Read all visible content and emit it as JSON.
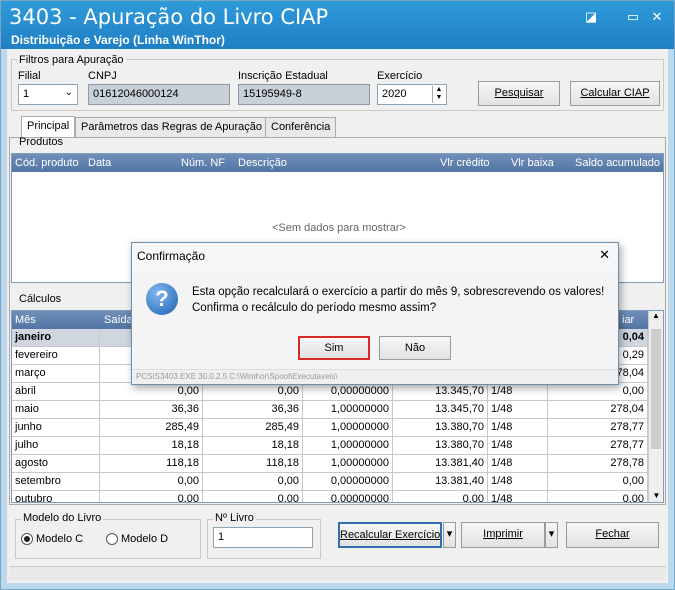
{
  "window": {
    "title": "3403 - Apuração do Livro CIAP",
    "subtitle": "Distribuição e Varejo (Linha WinThor)",
    "controls": {
      "restore": "◪",
      "minimize": "▭",
      "close": "✕"
    }
  },
  "filters": {
    "group_label": "Filtros para Apuração",
    "filial_label": "Filial",
    "filial_value": "1",
    "cnpj_label": "CNPJ",
    "cnpj_value": "01612046000124",
    "ie_label": "Inscrição Estadual",
    "ie_value": "15195949-8",
    "exercicio_label": "Exercício",
    "exercicio_value": "2020",
    "pesquisar_label": "Pesquisar",
    "calcular_label": "Calcular CIAP"
  },
  "tabs": [
    "Principal",
    "Parâmetros das Regras de Apuração",
    "Conferência"
  ],
  "produtos": {
    "label": "Produtos",
    "columns": [
      "Cód. produto",
      "Data",
      "Núm. NF",
      "Descrição",
      "Vlr crédito",
      "Vlr baixa",
      "Saldo acumulado"
    ],
    "empty_text": "<Sem dados para mostrar>"
  },
  "calculos": {
    "label": "Cálculos",
    "columns": [
      "Mês",
      "Saídas",
      "",
      "",
      "",
      "",
      "iar"
    ],
    "rows": [
      [
        "janeiro",
        "",
        "",
        "",
        "",
        "",
        "0,04"
      ],
      [
        "fevereiro",
        "",
        "",
        "",
        "",
        "",
        "0,29"
      ],
      [
        "março",
        "",
        "",
        "",
        "",
        "",
        "78,04"
      ],
      [
        "abril",
        "0,00",
        "0,00",
        "0,00000000",
        "13.345,70",
        "1/48",
        "0,00"
      ],
      [
        "maio",
        "36,36",
        "36,36",
        "1,00000000",
        "13.345,70",
        "1/48",
        "278,04"
      ],
      [
        "junho",
        "285,49",
        "285,49",
        "1,00000000",
        "13.380,70",
        "1/48",
        "278,77"
      ],
      [
        "julho",
        "18,18",
        "18,18",
        "1,00000000",
        "13.380,70",
        "1/48",
        "278,77"
      ],
      [
        "agosto",
        "118,18",
        "118,18",
        "1,00000000",
        "13.381,40",
        "1/48",
        "278,78"
      ],
      [
        "setembro",
        "0,00",
        "0,00",
        "0,00000000",
        "13.381,40",
        "1/48",
        "0,00"
      ],
      [
        "outubro",
        "0,00",
        "0,00",
        "0,00000000",
        "0,00",
        "1/48",
        "0,00"
      ]
    ]
  },
  "bottom": {
    "modelo_label": "Modelo do Livro",
    "modelo_c": "Modelo C",
    "modelo_d": "Modelo D",
    "num_livro_label": "Nº Livro",
    "num_livro_value": "1",
    "recalcular_label": "Recalcular Exercício",
    "imprimir_label": "Imprimir",
    "fechar_label": "Fechar"
  },
  "dialog": {
    "title": "Confirmação",
    "close": "✕",
    "icon": "question-icon",
    "message_line1": "Esta opção recalculará o exercício a partir do mês 9, sobrescrevendo os valores!",
    "message_line2": "Confirma o recálculo do período mesmo assim?",
    "yes_label": "Sim",
    "no_label": "Não",
    "footer": "PCSIS3403.EXE 30.0.2.5 C:\\Winthor\\Spool\\Executaveis\\"
  }
}
